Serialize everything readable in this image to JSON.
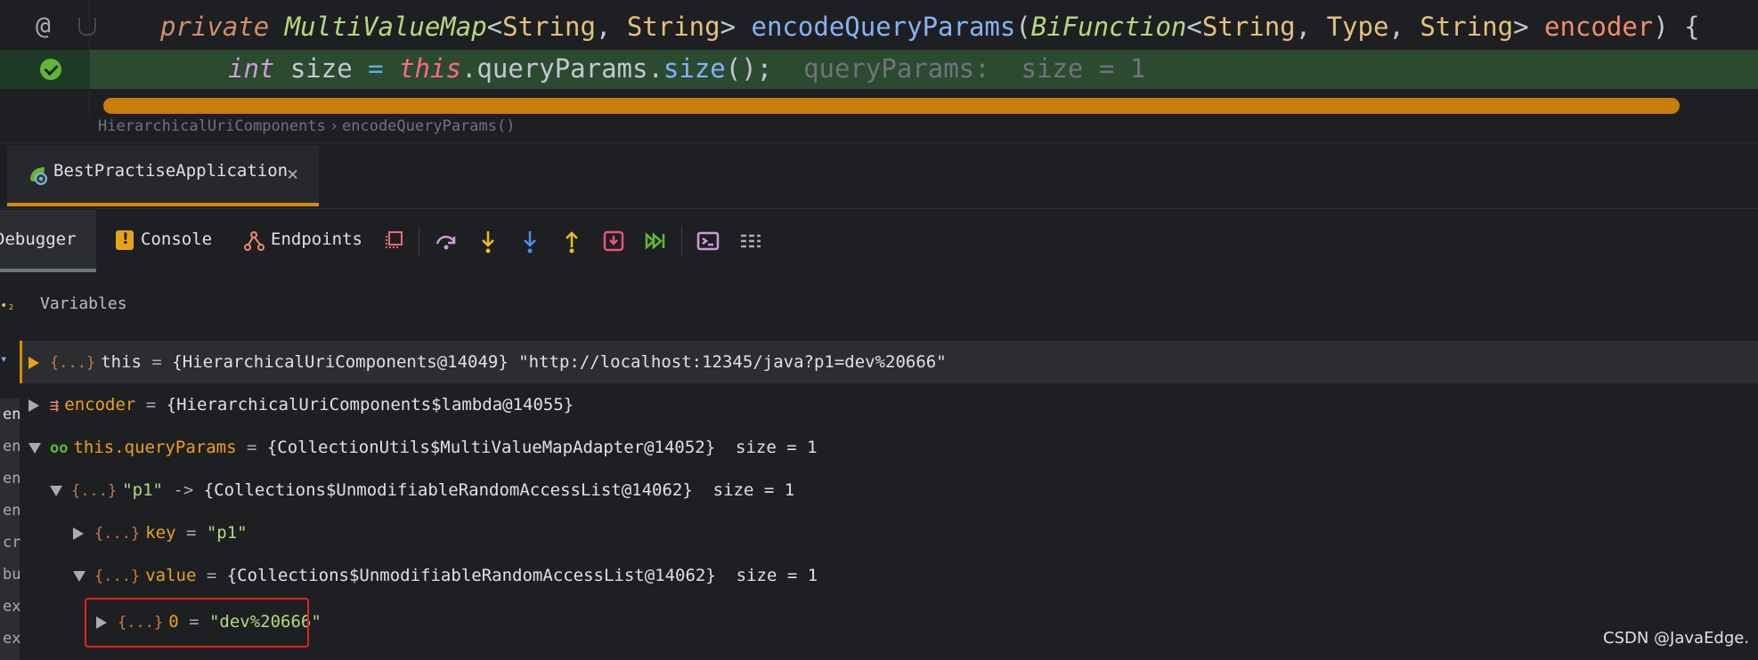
{
  "editor": {
    "line1": {
      "t1": "private ",
      "t2": "MultiValueMap",
      "t3": "<",
      "t4": "String",
      "t5": ", ",
      "t6": "String",
      "t7": "> ",
      "t8": "encodeQueryParams",
      "t9": "(",
      "t10": "BiFunction",
      "t11": "<",
      "t12": "String",
      "t13": ", ",
      "t14": "Type",
      "t15": ", ",
      "t16": "String",
      "t17": "> ",
      "t18": "encoder",
      "t19": ") {"
    },
    "line2": {
      "t1": "int",
      "t2": " size ",
      "t3": "=",
      "t4": " ",
      "t5": "this",
      "t6": ".queryParams.",
      "t7": "size",
      "t8": "();",
      "hint": "  queryParams:  size = 1"
    },
    "gutter_at": "@"
  },
  "breadcrumb": {
    "class": "HierarchicalUriComponents",
    "sep": "›",
    "method": "encodeQueryParams()"
  },
  "run_tab": {
    "label": "BestPractiseApplication",
    "close": "×"
  },
  "toolbar": {
    "debugger": "Debugger",
    "console": "Console",
    "endpoints": "Endpoints"
  },
  "variables": {
    "title": "Variables",
    "left_marks": "•₂",
    "rows": [
      {
        "icon": "{...}",
        "name": "this",
        "eq": " = ",
        "value": "{HierarchicalUriComponents@14049} ",
        "str": "\"http://localhost:12345/java?p1=dev%20666\""
      },
      {
        "icon": "⇶",
        "name": "encoder",
        "eq": " = ",
        "value": "{HierarchicalUriComponents$lambda@14055}"
      },
      {
        "icon": "oo",
        "name": "this.queryParams",
        "eq": " = ",
        "value": "{CollectionUtils$MultiValueMapAdapter@14052}",
        "extra": "  size = 1"
      },
      {
        "icon": "{...}",
        "name": "\"p1\"",
        "eq": " -> ",
        "value": "{Collections$UnmodifiableRandomAccessList@14062}",
        "extra": "  size = 1"
      },
      {
        "icon": "{...}",
        "name": "key",
        "eq": " = ",
        "str": "\"p1\""
      },
      {
        "icon": "{...}",
        "name": "value",
        "eq": " = ",
        "value": "{Collections$UnmodifiableRandomAccessList@14062}",
        "extra": "  size = 1"
      },
      {
        "icon": "{...}",
        "name": "0",
        "eq": " = ",
        "str": "\"dev%20666\""
      }
    ],
    "left_strip": [
      "en",
      "en",
      "en",
      "en",
      "cr",
      "bu",
      "ex",
      "ex"
    ]
  },
  "watermark": "CSDN @JavaEdge."
}
